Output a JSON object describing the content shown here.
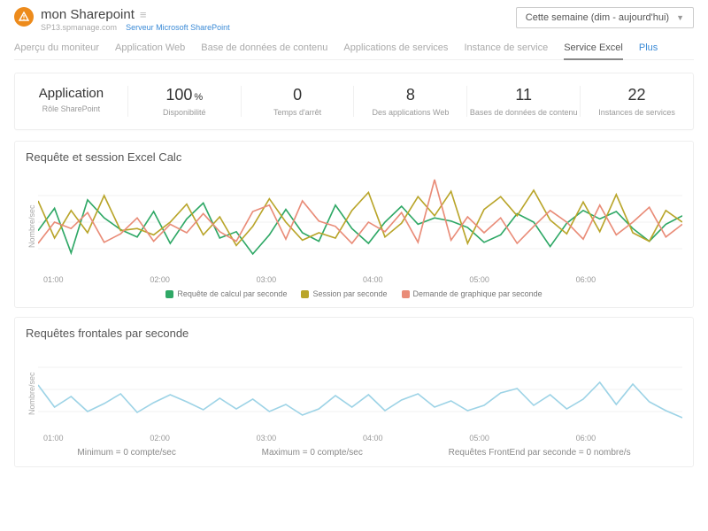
{
  "header": {
    "title": "mon Sharepoint",
    "host": "SP13.spmanage.com",
    "server_link": "Serveur Microsoft SharePoint",
    "time_range": "Cette semaine (dim - aujourd'hui)"
  },
  "tabs": {
    "items": [
      "Aperçu du moniteur",
      "Application Web",
      "Base de données de contenu",
      "Applications de services",
      "Instance de service",
      "Service Excel",
      "Plus"
    ],
    "active_index": 5,
    "plus_index": 6
  },
  "stats": [
    {
      "value": "Application",
      "label": "Rôle SharePoint",
      "is_text": true
    },
    {
      "value": "100",
      "suffix": "%",
      "label": "Disponibilité"
    },
    {
      "value": "0",
      "label": "Temps d'arrêt"
    },
    {
      "value": "8",
      "label": "Des applications Web"
    },
    {
      "value": "11",
      "label": "Bases de données de contenu"
    },
    {
      "value": "22",
      "label": "Instances de services"
    }
  ],
  "chart_data": [
    {
      "type": "line",
      "title": "Requête et session Excel Calc",
      "ylabel": "Nombre/sec",
      "xticks": [
        "01:00",
        "02:00",
        "03:00",
        "04:00",
        "05:00",
        "06:00"
      ],
      "ylim": [
        0,
        10
      ],
      "series": [
        {
          "name": "Requête de calcul par seconde",
          "color": "#2fa866",
          "values": [
            4.2,
            6.3,
            2.1,
            7.1,
            5.4,
            4.3,
            3.6,
            6.0,
            3.0,
            5.3,
            6.8,
            3.5,
            4.1,
            2.0,
            3.8,
            6.2,
            4.0,
            3.2,
            6.6,
            4.4,
            3.0,
            5.0,
            6.5,
            4.8,
            5.4,
            5.1,
            4.5,
            3.1,
            3.8,
            5.8,
            5.0,
            2.7,
            4.9,
            6.1,
            5.3,
            6.0,
            4.4,
            3.2,
            4.8,
            5.6
          ]
        },
        {
          "name": "Session par seconde",
          "color": "#b9a52a",
          "values": [
            7.0,
            3.5,
            6.1,
            4.0,
            7.5,
            4.2,
            4.4,
            3.8,
            5.0,
            6.7,
            3.8,
            5.5,
            2.8,
            4.6,
            7.2,
            5.0,
            3.3,
            4.0,
            3.5,
            6.1,
            7.8,
            3.6,
            4.9,
            7.4,
            5.6,
            7.9,
            3.0,
            6.2,
            7.4,
            5.6,
            8.0,
            5.2,
            3.9,
            6.9,
            4.1,
            7.6,
            4.0,
            3.2,
            6.1,
            5.0
          ]
        },
        {
          "name": "Demande de graphique par seconde",
          "color": "#e98c78",
          "values": [
            3.0,
            5.0,
            4.4,
            5.9,
            3.1,
            3.9,
            5.4,
            3.2,
            4.8,
            4.0,
            5.8,
            4.1,
            3.2,
            6.0,
            6.6,
            3.4,
            7.0,
            5.1,
            4.6,
            3.0,
            5.0,
            4.1,
            5.9,
            3.1,
            9.0,
            3.3,
            5.5,
            4.0,
            5.4,
            3.0,
            4.6,
            6.1,
            5.0,
            3.4,
            6.6,
            3.8,
            5.0,
            6.4,
            3.6,
            4.8
          ]
        }
      ]
    },
    {
      "type": "line",
      "title": "Requêtes frontales par seconde",
      "ylabel": "Nombre/sec",
      "xticks": [
        "01:00",
        "02:00",
        "03:00",
        "04:00",
        "05:00",
        "06:00"
      ],
      "ylim": [
        0,
        10
      ],
      "series": [
        {
          "name": "Requêtes FrontEnd par seconde",
          "color": "#9dd3e6",
          "values": [
            5.5,
            3.0,
            4.2,
            2.5,
            3.4,
            4.5,
            2.4,
            3.5,
            4.4,
            3.6,
            2.7,
            4.0,
            2.8,
            3.9,
            2.5,
            3.3,
            2.1,
            2.8,
            4.3,
            3.0,
            4.4,
            2.6,
            3.8,
            4.5,
            3.0,
            3.7,
            2.6,
            3.2,
            4.6,
            5.1,
            3.2,
            4.4,
            2.8,
            3.9,
            5.8,
            3.3,
            5.6,
            3.6,
            2.6,
            1.8
          ]
        }
      ],
      "substats": [
        "Minimum = 0 compte/sec",
        "Maximum = 0 compte/sec",
        "Requêtes FrontEnd par seconde = 0 nombre/s"
      ]
    }
  ]
}
